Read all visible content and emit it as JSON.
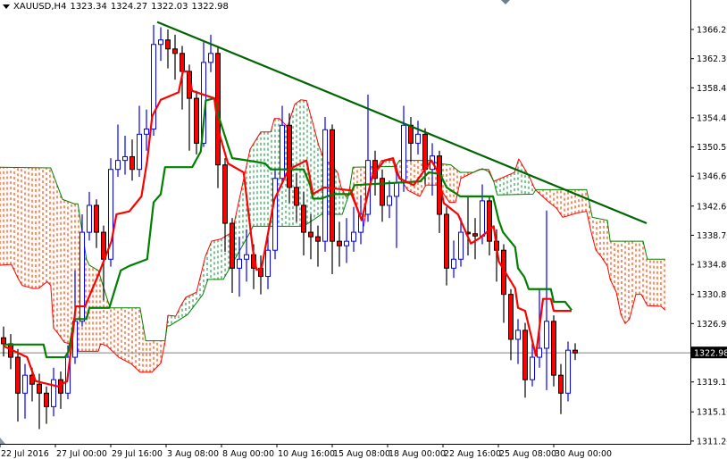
{
  "header": {
    "symbol": "XAUUSD,H4",
    "open": "1323.34",
    "high": "1324.27",
    "low": "1322.03",
    "close": "1322.98"
  },
  "chart_data": {
    "type": "candlestick",
    "title": "XAUUSD,H4",
    "ylim": [
      1311.2,
      1366.2
    ],
    "y_ticks": [
      "1366.20",
      "1362.30",
      "1358.40",
      "1354.40",
      "1350.50",
      "1346.60",
      "1342.60",
      "1338.70",
      "1334.80",
      "1330.80",
      "1326.90",
      "1319.10",
      "1315.10",
      "1311.20"
    ],
    "y_tick_values": [
      1366.2,
      1362.3,
      1358.4,
      1354.4,
      1350.5,
      1346.6,
      1342.6,
      1338.7,
      1334.8,
      1330.8,
      1326.9,
      1319.1,
      1315.1,
      1311.2
    ],
    "x_ticks": [
      "22 Jul 2016",
      "27 Jul 00:00",
      "29 Jul 16:00",
      "3 Aug 08:00",
      "8 Aug 00:00",
      "10 Aug 16:00",
      "15 Aug 08:00",
      "18 Aug 00:00",
      "22 Aug 16:00",
      "25 Aug 08:00",
      "30 Aug 00:00"
    ],
    "x_tick_index": [
      0,
      7.75,
      15.5,
      23.25,
      31,
      38.75,
      46.5,
      54.25,
      62,
      69.75,
      77.5
    ],
    "current_price": 1322.98,
    "current_price_label": "1322.98",
    "colors": {
      "bull": "#0000ff",
      "bear": "#ff0000",
      "tenkan": "#ff0000",
      "kijun": "#008000",
      "span_a": "#ff0000",
      "span_b": "#008000",
      "cloud_bear": "#ff4500",
      "cloud_bull": "#2e9e4f",
      "trendline": "#006400",
      "price_line": "#808080"
    },
    "candles": {
      "open": [
        1325.0,
        1324.2,
        1322.4,
        1317.6,
        1320.0,
        1318.8,
        1317.6,
        1315.8,
        1319.4,
        1317.6,
        1322.4,
        1327.2,
        1339.1,
        1342.7,
        1339.1,
        1335.5,
        1347.5,
        1348.7,
        1349.2,
        1347.5,
        1352.2,
        1352.9,
        1364.2,
        1364.8,
        1363.6,
        1363.0,
        1360.6,
        1357.0,
        1351.0,
        1361.8,
        1363.0,
        1348.1,
        1340.3,
        1334.3,
        1335.5,
        1336.1,
        1334.3,
        1333.2,
        1336.7,
        1346.3,
        1353.4,
        1345.1,
        1342.7,
        1339.1,
        1338.5,
        1337.9,
        1352.8,
        1337.9,
        1337.3,
        1337.9,
        1339.1,
        1341.5,
        1348.7,
        1346.3,
        1342.7,
        1343.9,
        1345.7,
        1353.4,
        1351.0,
        1352.2,
        1347.5,
        1349.3,
        1341.5,
        1334.3,
        1335.5,
        1339.1,
        1338.9,
        1338.6,
        1343.3,
        1337.9,
        1336.7,
        1330.8,
        1324.8,
        1326.0,
        1319.4,
        1322.4,
        1323.6,
        1327.2,
        1320.0,
        1317.6,
        1323.34
      ],
      "high": [
        1326.5,
        1325.5,
        1323.5,
        1321.5,
        1321.0,
        1320.2,
        1318.5,
        1321.0,
        1320.5,
        1324.0,
        1334.0,
        1341.5,
        1344.5,
        1343.5,
        1340.0,
        1349.0,
        1353.5,
        1352.0,
        1351.5,
        1356.0,
        1355.5,
        1366.8,
        1366.5,
        1366.2,
        1365.5,
        1364.0,
        1361.5,
        1358.0,
        1364.5,
        1365.5,
        1364.0,
        1349.0,
        1341.0,
        1338.5,
        1339.5,
        1337.5,
        1336.0,
        1338.5,
        1347.5,
        1356.0,
        1355.0,
        1347.0,
        1344.5,
        1341.5,
        1340.0,
        1354.5,
        1353.5,
        1340.5,
        1341.0,
        1342.5,
        1344.0,
        1357.5,
        1350.0,
        1347.5,
        1346.0,
        1348.0,
        1356.0,
        1354.5,
        1354.0,
        1353.0,
        1351.0,
        1350.0,
        1342.5,
        1338.0,
        1341.0,
        1344.0,
        1341.0,
        1345.5,
        1344.0,
        1339.5,
        1337.5,
        1331.5,
        1327.5,
        1327.0,
        1324.5,
        1331.5,
        1342.0,
        1328.0,
        1321.5,
        1324.5,
        1324.27
      ],
      "low": [
        1322.5,
        1320.8,
        1313.8,
        1314.2,
        1316.5,
        1312.8,
        1313.5,
        1314.5,
        1315.5,
        1316.8,
        1321.5,
        1326.5,
        1338.0,
        1337.0,
        1330.0,
        1334.5,
        1346.5,
        1346.8,
        1346.0,
        1346.5,
        1350.0,
        1352.0,
        1362.0,
        1361.0,
        1359.5,
        1355.5,
        1350.0,
        1349.5,
        1350.5,
        1360.5,
        1345.0,
        1336.5,
        1331.0,
        1330.5,
        1332.5,
        1331.5,
        1330.8,
        1331.5,
        1335.5,
        1345.5,
        1343.0,
        1340.5,
        1336.0,
        1335.5,
        1334.5,
        1336.5,
        1333.5,
        1334.5,
        1335.0,
        1336.5,
        1337.5,
        1340.5,
        1344.0,
        1340.5,
        1341.0,
        1337.0,
        1344.5,
        1348.5,
        1349.5,
        1345.5,
        1344.0,
        1339.0,
        1332.0,
        1333.0,
        1334.5,
        1336.0,
        1335.5,
        1337.5,
        1336.0,
        1332.5,
        1327.0,
        1322.0,
        1321.5,
        1317.0,
        1318.5,
        1321.0,
        1318.0,
        1318.5,
        1314.8,
        1316.5,
        1322.03
      ],
      "close": [
        1324.2,
        1322.4,
        1317.6,
        1320.0,
        1318.8,
        1317.6,
        1315.8,
        1319.4,
        1317.6,
        1322.4,
        1327.2,
        1339.1,
        1342.7,
        1339.1,
        1335.5,
        1347.5,
        1348.7,
        1349.2,
        1347.5,
        1352.2,
        1352.9,
        1364.2,
        1364.8,
        1363.6,
        1363.0,
        1360.6,
        1357.0,
        1351.0,
        1361.8,
        1363.0,
        1348.1,
        1340.3,
        1334.3,
        1335.5,
        1336.1,
        1334.3,
        1333.2,
        1336.7,
        1346.3,
        1353.4,
        1345.1,
        1342.7,
        1339.1,
        1338.5,
        1337.9,
        1352.8,
        1337.9,
        1337.3,
        1337.9,
        1339.1,
        1341.5,
        1348.7,
        1346.3,
        1342.7,
        1343.9,
        1345.7,
        1353.4,
        1351.0,
        1352.2,
        1347.5,
        1349.3,
        1341.5,
        1334.3,
        1335.5,
        1339.1,
        1338.9,
        1338.6,
        1343.3,
        1337.9,
        1336.7,
        1330.8,
        1324.8,
        1326.0,
        1319.4,
        1322.4,
        1323.6,
        1327.2,
        1320.0,
        1317.6,
        1323.34,
        1322.98
      ]
    },
    "ichimoku": {
      "tenkan": [
        [
          0,
          1323.9
        ],
        [
          3.3,
          1322.4
        ],
        [
          4.5,
          1319.2
        ],
        [
          7.6,
          1318.5
        ],
        [
          8.9,
          1319.2
        ],
        [
          9.5,
          1323.9
        ],
        [
          10.1,
          1329.2
        ],
        [
          11.4,
          1329.2
        ],
        [
          13.3,
          1333.5
        ],
        [
          15.1,
          1337.9
        ],
        [
          15.8,
          1341.5
        ],
        [
          17.6,
          1341.9
        ],
        [
          19.3,
          1343.9
        ],
        [
          20.1,
          1348.7
        ],
        [
          20.8,
          1354.6
        ],
        [
          22,
          1356.8
        ],
        [
          24.5,
          1357.8
        ],
        [
          25.1,
          1360.6
        ],
        [
          25.8,
          1360.6
        ],
        [
          26.4,
          1358.0
        ],
        [
          29.5,
          1357.0
        ],
        [
          30.1,
          1352.6
        ],
        [
          31.4,
          1348.3
        ],
        [
          33.6,
          1347.1
        ],
        [
          34.9,
          1336.7
        ],
        [
          35.4,
          1334.1
        ],
        [
          36.1,
          1334.3
        ],
        [
          37.9,
          1343.5
        ],
        [
          39.9,
          1347.5
        ],
        [
          42.4,
          1348.7
        ],
        [
          43.3,
          1344.2
        ],
        [
          44.9,
          1345.1
        ],
        [
          48.6,
          1344.7
        ],
        [
          50.1,
          1340.7
        ],
        [
          51.6,
          1346.6
        ],
        [
          53.3,
          1348.7
        ],
        [
          54.5,
          1349.0
        ],
        [
          55.4,
          1346.3
        ],
        [
          57.4,
          1345.4
        ],
        [
          59.9,
          1348.7
        ],
        [
          60.8,
          1347.1
        ],
        [
          61.6,
          1343.0
        ],
        [
          63.6,
          1341.5
        ],
        [
          65.4,
          1337.6
        ],
        [
          66.6,
          1338.3
        ],
        [
          68.6,
          1339.9
        ],
        [
          69.3,
          1335.2
        ],
        [
          71.6,
          1331.6
        ],
        [
          72,
          1329.0
        ],
        [
          73,
          1328.6
        ],
        [
          74.5,
          1322.6
        ],
        [
          75.5,
          1330.2
        ],
        [
          76.6,
          1330.2
        ],
        [
          77,
          1328.6
        ],
        [
          79.5,
          1328.6
        ]
      ],
      "kijun": [
        [
          0,
          1324.1
        ],
        [
          5.6,
          1324.1
        ],
        [
          6,
          1322.4
        ],
        [
          8.6,
          1322.4
        ],
        [
          9.1,
          1323.2
        ],
        [
          9.9,
          1327.5
        ],
        [
          11.6,
          1327.5
        ],
        [
          12,
          1329.0
        ],
        [
          14.8,
          1329.0
        ],
        [
          16.4,
          1334.0
        ],
        [
          17.6,
          1334.6
        ],
        [
          20.1,
          1335.5
        ],
        [
          21,
          1343.1
        ],
        [
          22,
          1344.2
        ],
        [
          22.6,
          1347.8
        ],
        [
          26.4,
          1347.8
        ],
        [
          27.6,
          1349.9
        ],
        [
          28.3,
          1356.7
        ],
        [
          29.5,
          1357.0
        ],
        [
          30.1,
          1354.6
        ],
        [
          31.4,
          1350.7
        ],
        [
          32,
          1349.0
        ],
        [
          34.1,
          1348.7
        ],
        [
          36.6,
          1348.3
        ],
        [
          37.4,
          1347.5
        ],
        [
          42,
          1347.5
        ],
        [
          42.9,
          1345.4
        ],
        [
          43.3,
          1343.6
        ],
        [
          44.5,
          1343.6
        ],
        [
          46.1,
          1344.2
        ],
        [
          48.6,
          1344.2
        ],
        [
          49.1,
          1345.4
        ],
        [
          58.3,
          1345.9
        ],
        [
          59.5,
          1347.1
        ],
        [
          61.1,
          1346.9
        ],
        [
          62,
          1345.1
        ],
        [
          63.9,
          1343.9
        ],
        [
          68.5,
          1343.9
        ],
        [
          69.3,
          1340.7
        ],
        [
          69.9,
          1339.1
        ],
        [
          71.6,
          1337.1
        ],
        [
          72,
          1334.3
        ],
        [
          72.9,
          1333.1
        ],
        [
          73.5,
          1331.5
        ],
        [
          76.6,
          1331.5
        ],
        [
          77,
          1329.8
        ],
        [
          78.6,
          1329.8
        ],
        [
          79.5,
          1328.7
        ]
      ],
      "span_a": [
        [
          -0.5,
          1334.7
        ],
        [
          1.1,
          1334.8
        ],
        [
          2,
          1333.0
        ],
        [
          2.6,
          1332.0
        ],
        [
          4.1,
          1331.6
        ],
        [
          4.9,
          1331.6
        ],
        [
          6.1,
          1332.5
        ],
        [
          6.6,
          1332.0
        ],
        [
          7,
          1326.3
        ],
        [
          7.6,
          1325.6
        ],
        [
          8.5,
          1324.4
        ],
        [
          9.25,
          1324.2
        ],
        [
          10.1,
          1325.5
        ],
        [
          10.4,
          1323.2
        ],
        [
          13.25,
          1323.2
        ],
        [
          13.6,
          1324.2
        ],
        [
          14.5,
          1323.9
        ],
        [
          16.1,
          1322.4
        ],
        [
          17.9,
          1321.5
        ],
        [
          19.1,
          1320.4
        ],
        [
          20.75,
          1320.4
        ],
        [
          22,
          1321.6
        ],
        [
          22.6,
          1324.4
        ],
        [
          23,
          1328.0
        ],
        [
          24.1,
          1327.9
        ],
        [
          24.75,
          1329.2
        ],
        [
          25.5,
          1330.4
        ],
        [
          27,
          1331.1
        ],
        [
          28.25,
          1335.9
        ],
        [
          29.1,
          1337.9
        ],
        [
          30.4,
          1338.2
        ],
        [
          32,
          1339.1
        ],
        [
          34.5,
          1350.2
        ],
        [
          36,
          1352.5
        ],
        [
          37.4,
          1352.5
        ],
        [
          37.9,
          1354.3
        ],
        [
          38.6,
          1354.3
        ],
        [
          39.75,
          1353.2
        ],
        [
          40.75,
          1356.2
        ],
        [
          41.6,
          1356.8
        ],
        [
          42.4,
          1356.7
        ],
        [
          43.25,
          1353.8
        ],
        [
          44.1,
          1350.7
        ],
        [
          44.9,
          1348.7
        ],
        [
          45.75,
          1348.3
        ],
        [
          46.75,
          1347.1
        ],
        [
          47.25,
          1345.1
        ],
        [
          47.9,
          1343.9
        ],
        [
          48.6,
          1344.2
        ],
        [
          50.4,
          1339.9
        ],
        [
          51.6,
          1346.6
        ],
        [
          52.9,
          1348.7
        ],
        [
          54.5,
          1348.7
        ],
        [
          54.9,
          1347.1
        ],
        [
          55.75,
          1345.9
        ],
        [
          56.6,
          1344.7
        ],
        [
          58.25,
          1343.9
        ],
        [
          59.1,
          1345.4
        ],
        [
          60.75,
          1345.4
        ],
        [
          62.4,
          1343.1
        ],
        [
          63.25,
          1343.1
        ],
        [
          64,
          1346.3
        ],
        [
          66.6,
          1347.5
        ],
        [
          67.9,
          1347.5
        ],
        [
          68.6,
          1345.9
        ],
        [
          71.5,
          1347.1
        ],
        [
          72.1,
          1348.9
        ],
        [
          73.6,
          1346.5
        ],
        [
          74.25,
          1345.1
        ],
        [
          74.5,
          1344.7
        ],
        [
          76.1,
          1343.3
        ],
        [
          77.4,
          1342.3
        ],
        [
          78.25,
          1341.1
        ],
        [
          80.4,
          1341.7
        ],
        [
          81.6,
          1341.9
        ],
        [
          82.25,
          1339.1
        ],
        [
          82.9,
          1336.7
        ],
        [
          83.6,
          1335.9
        ],
        [
          84.5,
          1334.6
        ],
        [
          84.9,
          1332.8
        ],
        [
          85.75,
          1331.1
        ],
        [
          86.4,
          1328.1
        ],
        [
          87,
          1326.9
        ],
        [
          87.6,
          1327.5
        ],
        [
          88.5,
          1330.8
        ],
        [
          89.25,
          1330.8
        ],
        [
          90.1,
          1329.3
        ],
        [
          92,
          1329.2
        ],
        [
          92.6,
          1328.7
        ]
      ],
      "span_b": [
        [
          -0.5,
          1347.8
        ],
        [
          6.6,
          1347.7
        ],
        [
          8.25,
          1343.5
        ],
        [
          9.9,
          1342.9
        ],
        [
          10.4,
          1342.9
        ],
        [
          11.6,
          1335.5
        ],
        [
          12,
          1334.7
        ],
        [
          13.25,
          1334.0
        ],
        [
          14.9,
          1329.0
        ],
        [
          19.1,
          1329.0
        ],
        [
          19.9,
          1324.6
        ],
        [
          22.6,
          1324.6
        ],
        [
          22.9,
          1326.6
        ],
        [
          23.25,
          1326.6
        ],
        [
          25.75,
          1328.1
        ],
        [
          27.9,
          1330.8
        ],
        [
          28.6,
          1332.8
        ],
        [
          30.75,
          1332.8
        ],
        [
          34.5,
          1339.1
        ],
        [
          34.9,
          1339.9
        ],
        [
          42,
          1339.9
        ],
        [
          43.25,
          1340.7
        ],
        [
          44.5,
          1341.5
        ],
        [
          47.4,
          1341.5
        ],
        [
          48.25,
          1343.9
        ],
        [
          48.9,
          1347.8
        ],
        [
          54.9,
          1347.9
        ],
        [
          55.4,
          1348.7
        ],
        [
          59.9,
          1348.7
        ],
        [
          60.75,
          1348.3
        ],
        [
          62.6,
          1348.1
        ],
        [
          63.9,
          1347.1
        ],
        [
          65.75,
          1347.1
        ],
        [
          67,
          1347.6
        ],
        [
          67.9,
          1347.2
        ],
        [
          68.6,
          1345.9
        ],
        [
          69.1,
          1344.1
        ],
        [
          74.1,
          1344.2
        ],
        [
          74.5,
          1344.8
        ],
        [
          81.6,
          1344.8
        ],
        [
          82.4,
          1341.1
        ],
        [
          84.5,
          1340.7
        ],
        [
          84.9,
          1337.9
        ],
        [
          89.5,
          1337.9
        ],
        [
          90.1,
          1335.5
        ],
        [
          92.6,
          1335.5
        ]
      ]
    },
    "trendline": [
      [
        21.5,
        1367.2
      ],
      [
        90,
        1340.3
      ]
    ]
  }
}
